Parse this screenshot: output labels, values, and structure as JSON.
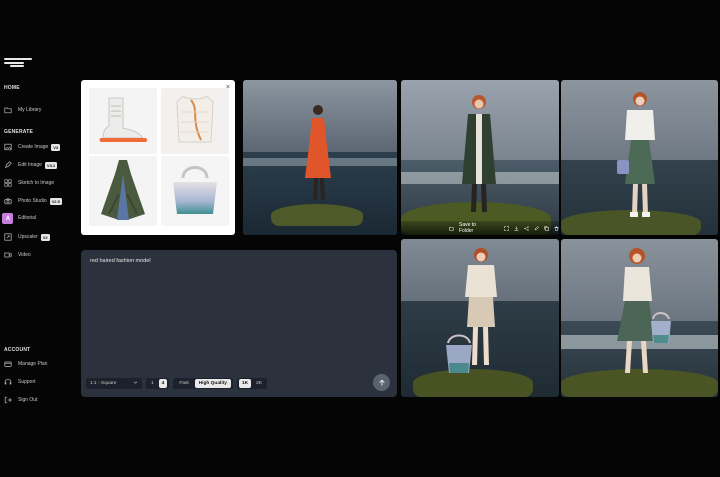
{
  "sidebar": {
    "sections": {
      "home": "HOME",
      "generate": "GENERATE",
      "account": "ACCOUNT"
    },
    "home_items": [
      {
        "label": "My Library",
        "icon": "folder-icon"
      }
    ],
    "generate_items": [
      {
        "label": "Create Image",
        "badge": "V3",
        "icon": "image-icon"
      },
      {
        "label": "Edit Image",
        "badge": "V3.1",
        "icon": "pencil-icon"
      },
      {
        "label": "Sketch to Image",
        "badge": "",
        "icon": "grid-icon"
      },
      {
        "label": "Photo Studio",
        "badge": "V2.5",
        "icon": "camera-icon"
      },
      {
        "label": "Editorial",
        "badge": "",
        "icon": "editorial-icon",
        "active": true
      },
      {
        "label": "Upscaler",
        "badge": "V2",
        "icon": "upscale-icon"
      },
      {
        "label": "Video",
        "badge": "",
        "icon": "video-icon"
      }
    ],
    "account_items": [
      {
        "label": "Manage Plan",
        "icon": "card-icon"
      },
      {
        "label": "Support",
        "icon": "support-icon"
      },
      {
        "label": "Sign Out",
        "icon": "signout-icon"
      }
    ]
  },
  "reference_panel": {
    "close": "×"
  },
  "prompt": {
    "text": "red haired fashion model",
    "aspect": "1:1 - Square",
    "count_options": [
      "1",
      "4"
    ],
    "count_selected": "4",
    "speed_fast": "Fast",
    "speed_hq": "High Quality",
    "res_1k": "1K",
    "res_2k": "2K"
  },
  "photo_overlay": {
    "save_label": "Save to Folder"
  },
  "colors": {
    "accent_editorial": "#c77dde",
    "prompt_bg": "#2b323d"
  }
}
